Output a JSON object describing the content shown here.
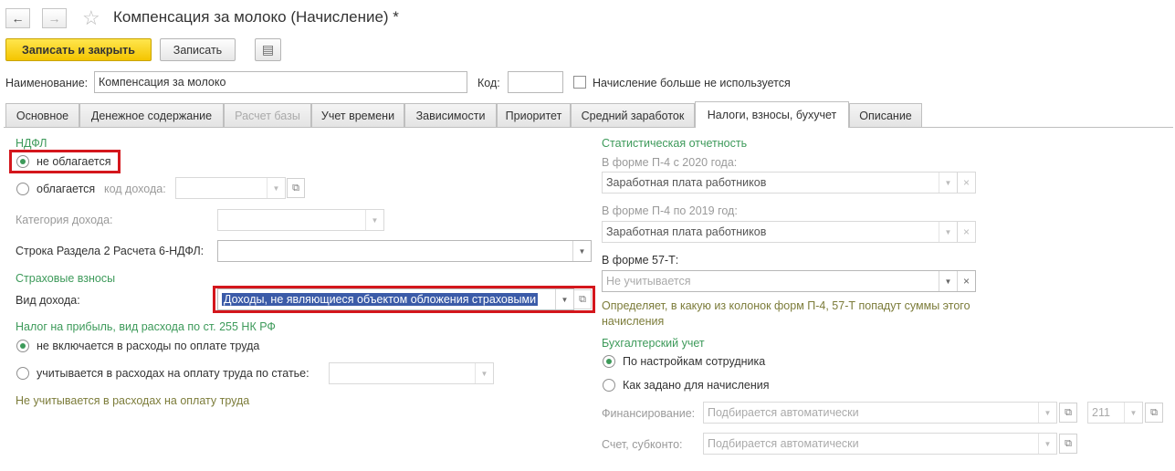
{
  "header": {
    "back_icon": "←",
    "forward_icon": "→",
    "star_icon": "☆",
    "title": "Компенсация за молоко (Начисление) *"
  },
  "toolbar": {
    "save_close_label": "Записать и закрыть",
    "save_label": "Записать",
    "menu_icon": "▤"
  },
  "top": {
    "name_label": "Наименование:",
    "name_value": "Компенсация за молоко",
    "code_label": "Код:",
    "code_value": "",
    "unused_label": "Начисление больше не используется"
  },
  "tabs": [
    {
      "label": "Основное"
    },
    {
      "label": "Денежное содержание"
    },
    {
      "label": "Расчет базы"
    },
    {
      "label": "Учет времени"
    },
    {
      "label": "Зависимости"
    },
    {
      "label": "Приоритет"
    },
    {
      "label": "Средний заработок"
    },
    {
      "label": "Налоги, взносы, бухучет"
    },
    {
      "label": "Описание"
    }
  ],
  "left": {
    "ndfl_header": "НДФЛ",
    "not_taxed_label": "не облагается",
    "taxed_label": "облагается",
    "income_code_label": "код дохода:",
    "income_category_label": "Категория дохода:",
    "report_line_label": "Строка Раздела 2 Расчета 6-НДФЛ:",
    "insurance_header": "Страховые взносы",
    "income_type_label": "Вид дохода:",
    "income_type_value": "Доходы, не являющиеся объектом обложения страховыми",
    "profit_tax_header": "Налог на прибыль, вид расхода по ст. 255 НК РФ",
    "not_included_label": "не включается в расходы по оплате труда",
    "included_label": "учитывается в расходах на оплату труда по статье:",
    "profit_note": "Не учитывается в расходах на оплату труда"
  },
  "right": {
    "stat_header": "Статистическая отчетность",
    "p4_2020_label": "В форме П-4 с 2020 года:",
    "p4_2020_value": "Заработная плата работников",
    "p4_2019_label": "В форме П-4 по 2019 год:",
    "p4_2019_value": "Заработная плата работников",
    "f57_label": "В форме 57-Т:",
    "f57_placeholder": "Не учитывается",
    "stat_note": "Определяет, в какую из колонок форм П-4, 57-Т попадут суммы этого начисления",
    "accounting_header": "Бухгалтерский учет",
    "by_employee_label": "По настройкам сотрудника",
    "as_set_label": "Как задано для начисления",
    "financing_label": "Финансирование:",
    "financing_placeholder": "Подбирается автоматически",
    "financing_code": "211",
    "account_label": "Счет, субконто:",
    "account_placeholder": "Подбирается автоматически"
  },
  "colors": {
    "accent_green": "#3d9a5a",
    "highlight_red": "#d4161c",
    "primary_yellow": "#f4c500",
    "selection_blue": "#3b5ba8"
  }
}
